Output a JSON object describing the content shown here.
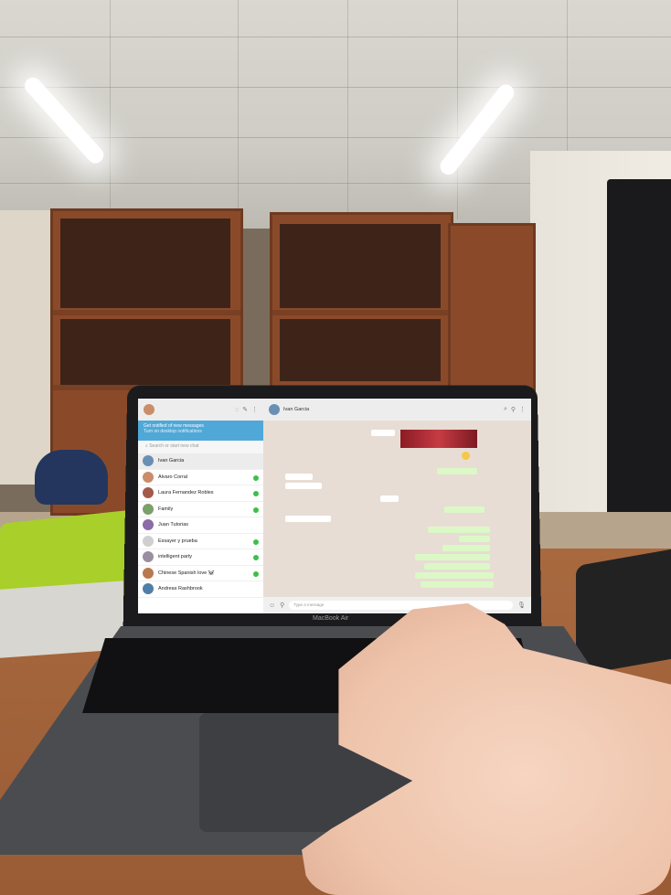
{
  "laptop": {
    "brand": "MacBook Air"
  },
  "whatsapp": {
    "sidebar": {
      "notice_title": "Get notified of new messages",
      "notice_sub": "Turn on desktop notifications",
      "search_placeholder": "Search or start new chat",
      "chats": [
        {
          "name": "Ivan Garcia",
          "preview": "",
          "time": "",
          "badge": false,
          "active": true
        },
        {
          "name": "Alvaro Corral",
          "preview": "",
          "time": "",
          "badge": true,
          "active": false
        },
        {
          "name": "Laura Fernandez Robles",
          "preview": "",
          "time": "",
          "badge": true,
          "active": false
        },
        {
          "name": "Family",
          "preview": "",
          "time": "",
          "badge": true,
          "active": false
        },
        {
          "name": "Juan Tutorias",
          "preview": "",
          "time": "",
          "badge": false,
          "active": false
        },
        {
          "name": "Essayer y prueba",
          "preview": "",
          "time": "",
          "badge": true,
          "active": false
        },
        {
          "name": "intelligent party",
          "preview": "",
          "time": "",
          "badge": true,
          "active": false
        },
        {
          "name": "Chinese Spanish love 🐼",
          "preview": "",
          "time": "",
          "badge": true,
          "active": false
        },
        {
          "name": "Andreas Rashbrook",
          "preview": "",
          "time": "",
          "badge": false,
          "active": false
        }
      ]
    },
    "conversation": {
      "contact_name": "Ivan Garcia",
      "contact_status": "",
      "compose_placeholder": "Type a message"
    }
  },
  "colors": {
    "whatsapp_header": "#ededed",
    "whatsapp_notice": "#4fa8d8",
    "bubble_out": "#dcf8c6",
    "bubble_in": "#ffffff",
    "chat_background": "#e7ddd4",
    "unread_badge": "#3cbf4a"
  }
}
